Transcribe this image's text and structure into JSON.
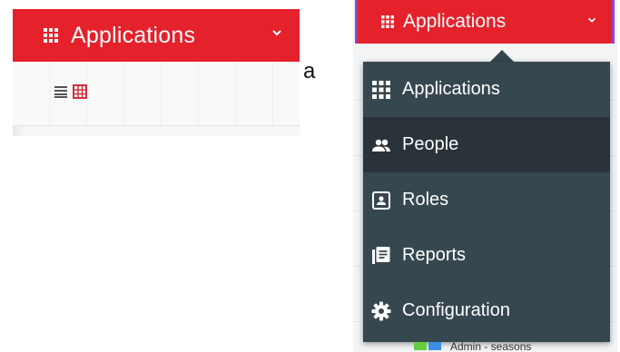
{
  "left": {
    "app_title": "Applications",
    "toolbar_icons": [
      "list-view-icon",
      "table-view-icon"
    ]
  },
  "caption": "a",
  "right": {
    "app_title": "Applications",
    "menu": [
      {
        "label": "Applications",
        "icon": "grid-icon",
        "active": false
      },
      {
        "label": "People",
        "icon": "people-icon",
        "active": true
      },
      {
        "label": "Roles",
        "icon": "badge-icon",
        "active": false
      },
      {
        "label": "Reports",
        "icon": "reports-icon",
        "active": false
      },
      {
        "label": "Configuration",
        "icon": "gear-icon",
        "active": false
      }
    ],
    "peek_text": "Admin - seasons"
  },
  "colors": {
    "brand_red": "#e5212b",
    "menu_bg": "#37474f",
    "menu_active_bg": "#2a3339",
    "accent_purple": "#8a4bc0"
  }
}
